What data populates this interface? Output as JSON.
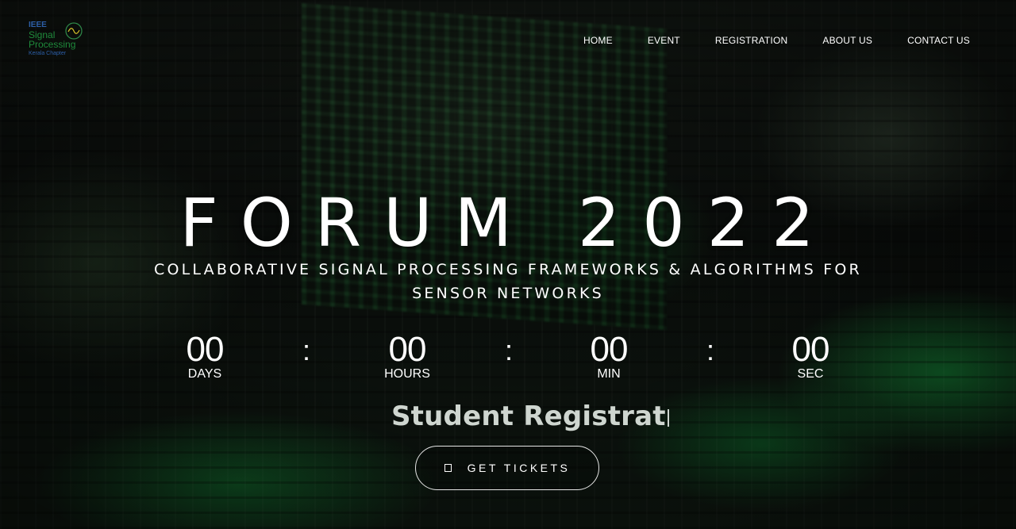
{
  "nav": {
    "logo": {
      "line1": "IEEE",
      "line2": "Signal",
      "line3": "Processing",
      "line4": "Kerala Chapter"
    },
    "items": [
      {
        "label": "HOME"
      },
      {
        "label": "EVENT"
      },
      {
        "label": "REGISTRATION"
      },
      {
        "label": "ABOUT US"
      },
      {
        "label": "CONTACT US"
      }
    ]
  },
  "hero": {
    "title": "FORUM 2022",
    "subtitle": "COLLABORATIVE SIGNAL PROCESSING FRAMEWORKS & ALGORITHMS FOR SENSOR NETWORKS"
  },
  "countdown": {
    "separator": ":",
    "units": [
      {
        "value": "00",
        "label": "DAYS"
      },
      {
        "value": "00",
        "label": "HOURS"
      },
      {
        "value": "00",
        "label": "MIN"
      },
      {
        "value": "00",
        "label": "SEC"
      }
    ]
  },
  "typed_text": "Student Registrat",
  "cta": {
    "label": "GET TICKETS",
    "icon": "ticket-icon"
  },
  "colors": {
    "accent_green": "#19b34b",
    "text": "#ffffff"
  }
}
